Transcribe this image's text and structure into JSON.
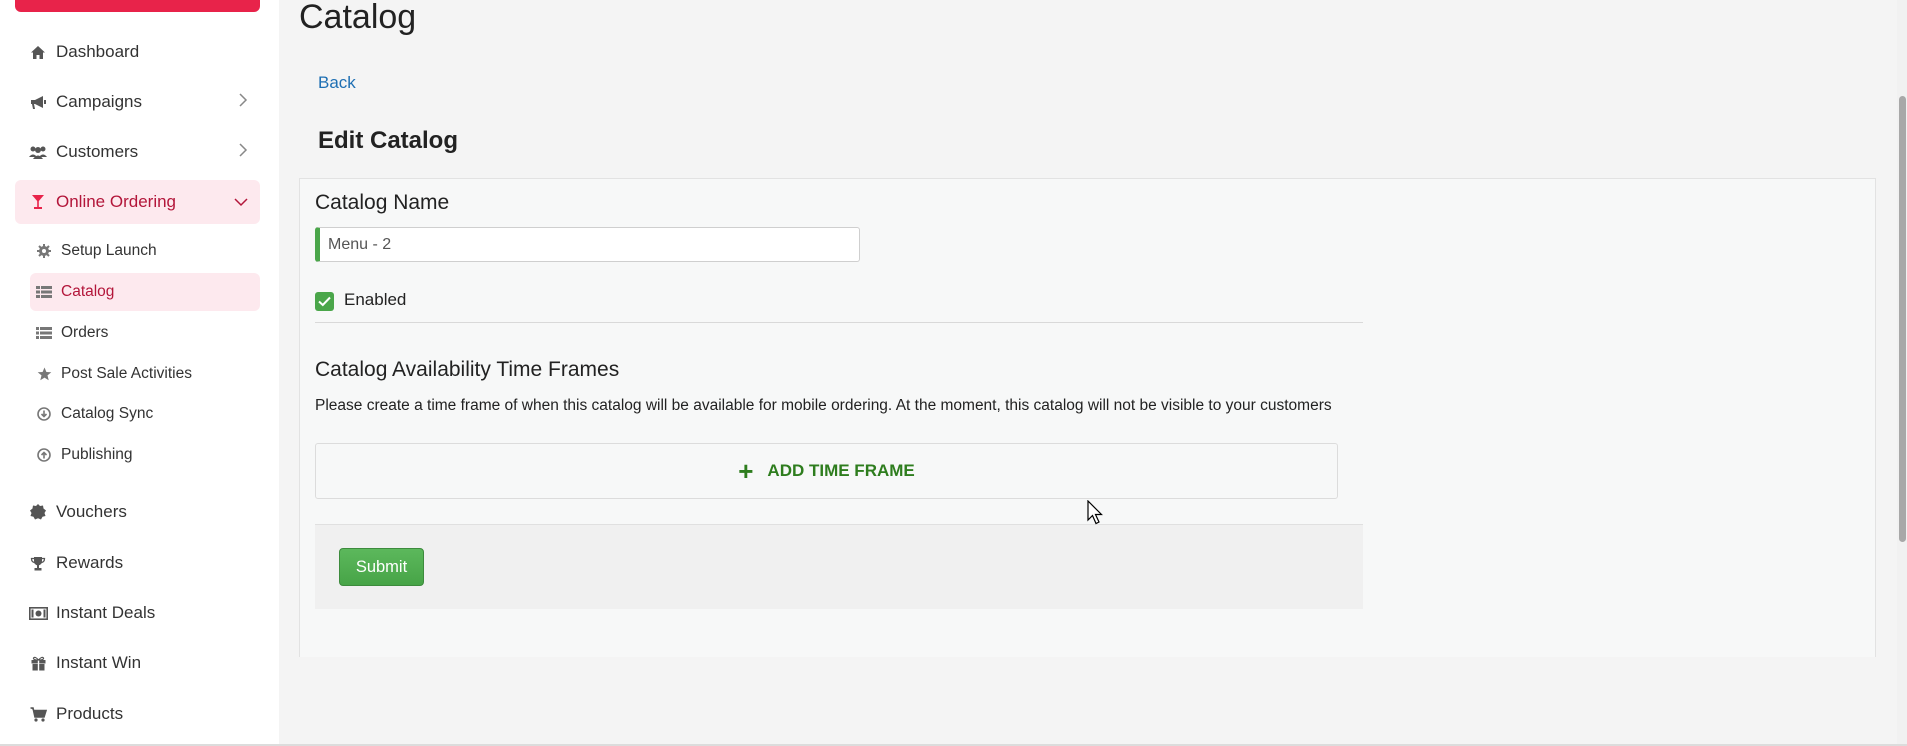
{
  "sidebar": {
    "items": [
      {
        "label": "Dashboard",
        "icon": "home-icon"
      },
      {
        "label": "Campaigns",
        "icon": "megaphone-icon"
      },
      {
        "label": "Customers",
        "icon": "users-icon"
      },
      {
        "label": "Online Ordering",
        "icon": "cocktail-icon"
      },
      {
        "label": "Vouchers",
        "icon": "badge-icon"
      },
      {
        "label": "Rewards",
        "icon": "trophy-icon"
      },
      {
        "label": "Instant Deals",
        "icon": "money-icon"
      },
      {
        "label": "Instant Win",
        "icon": "gift-icon"
      },
      {
        "label": "Products",
        "icon": "cart-icon"
      }
    ],
    "subitems": [
      {
        "label": "Setup Launch",
        "icon": "gear-icon"
      },
      {
        "label": "Catalog",
        "icon": "catalog-icon"
      },
      {
        "label": "Orders",
        "icon": "list-icon"
      },
      {
        "label": "Post Sale Activities",
        "icon": "star-icon"
      },
      {
        "label": "Catalog Sync",
        "icon": "download-circle-icon"
      },
      {
        "label": "Publishing",
        "icon": "upload-circle-icon"
      }
    ]
  },
  "main": {
    "page_title": "Catalog",
    "back_label": "Back",
    "section_title": "Edit Catalog",
    "catalog_name_label": "Catalog Name",
    "catalog_name_value": "Menu - 2",
    "enabled_label": "Enabled",
    "availability_title": "Catalog Availability Time Frames",
    "availability_help": "Please create a time frame of when this catalog will be available for mobile ordering. At the moment, this catalog will not be visible to your customers",
    "add_time_frame_label": "ADD TIME FRAME",
    "submit_label": "Submit"
  },
  "colors": {
    "brand": "#e8234a",
    "active_bg": "#fde9ee",
    "active_text": "#b3163a",
    "success": "#4aa64a",
    "link": "#1e6fb3"
  }
}
